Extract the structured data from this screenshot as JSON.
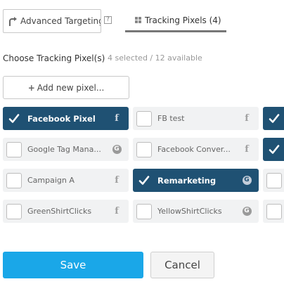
{
  "tabs": {
    "advanced_label": "Advanced Targeting",
    "help_glyph": "?",
    "pixels_label": "Tracking Pixels (4)"
  },
  "choose": {
    "label": "Choose Tracking Pixel(s)",
    "count": "4 selected / 12 available"
  },
  "add_button": {
    "label": "Add new pixel...",
    "plus": "+"
  },
  "pixels": [
    {
      "label": "Facebook Pixel",
      "service": "facebook-icon",
      "selected": true
    },
    {
      "label": "FB test",
      "service": "facebook-icon",
      "selected": false
    },
    {
      "label": "",
      "service": "",
      "selected": true
    },
    {
      "label": "Google Tag Mana...",
      "service": "google-icon",
      "selected": false
    },
    {
      "label": "Facebook Conver...",
      "service": "facebook-icon",
      "selected": false
    },
    {
      "label": "",
      "service": "",
      "selected": true
    },
    {
      "label": "Campaign A",
      "service": "facebook-icon",
      "selected": false
    },
    {
      "label": "Remarketing",
      "service": "google-icon",
      "selected": true
    },
    {
      "label": "",
      "service": "",
      "selected": false
    },
    {
      "label": "GreenShirtClicks",
      "service": "facebook-icon",
      "selected": false
    },
    {
      "label": "YellowShirtClicks",
      "service": "google-icon",
      "selected": false
    },
    {
      "label": "",
      "service": "",
      "selected": false
    }
  ],
  "icons": {
    "facebook": "f",
    "google": "G"
  },
  "colors": {
    "selected": "#1f5173",
    "save": "#1aa7e8",
    "chip": "#f1f2f3"
  },
  "footer": {
    "save_label": "Save",
    "cancel_label": "Cancel"
  }
}
